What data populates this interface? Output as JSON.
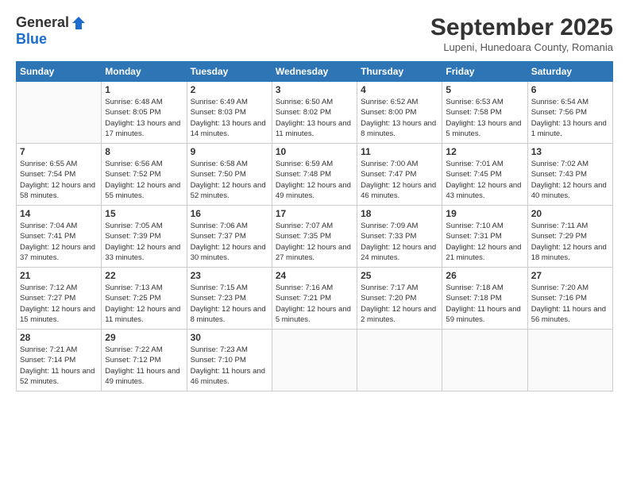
{
  "header": {
    "logo_general": "General",
    "logo_blue": "Blue",
    "month_title": "September 2025",
    "location": "Lupeni, Hunedoara County, Romania"
  },
  "weekdays": [
    "Sunday",
    "Monday",
    "Tuesday",
    "Wednesday",
    "Thursday",
    "Friday",
    "Saturday"
  ],
  "weeks": [
    [
      {
        "day": "",
        "sunrise": "",
        "sunset": "",
        "daylight": ""
      },
      {
        "day": "1",
        "sunrise": "Sunrise: 6:48 AM",
        "sunset": "Sunset: 8:05 PM",
        "daylight": "Daylight: 13 hours and 17 minutes."
      },
      {
        "day": "2",
        "sunrise": "Sunrise: 6:49 AM",
        "sunset": "Sunset: 8:03 PM",
        "daylight": "Daylight: 13 hours and 14 minutes."
      },
      {
        "day": "3",
        "sunrise": "Sunrise: 6:50 AM",
        "sunset": "Sunset: 8:02 PM",
        "daylight": "Daylight: 13 hours and 11 minutes."
      },
      {
        "day": "4",
        "sunrise": "Sunrise: 6:52 AM",
        "sunset": "Sunset: 8:00 PM",
        "daylight": "Daylight: 13 hours and 8 minutes."
      },
      {
        "day": "5",
        "sunrise": "Sunrise: 6:53 AM",
        "sunset": "Sunset: 7:58 PM",
        "daylight": "Daylight: 13 hours and 5 minutes."
      },
      {
        "day": "6",
        "sunrise": "Sunrise: 6:54 AM",
        "sunset": "Sunset: 7:56 PM",
        "daylight": "Daylight: 13 hours and 1 minute."
      }
    ],
    [
      {
        "day": "7",
        "sunrise": "Sunrise: 6:55 AM",
        "sunset": "Sunset: 7:54 PM",
        "daylight": "Daylight: 12 hours and 58 minutes."
      },
      {
        "day": "8",
        "sunrise": "Sunrise: 6:56 AM",
        "sunset": "Sunset: 7:52 PM",
        "daylight": "Daylight: 12 hours and 55 minutes."
      },
      {
        "day": "9",
        "sunrise": "Sunrise: 6:58 AM",
        "sunset": "Sunset: 7:50 PM",
        "daylight": "Daylight: 12 hours and 52 minutes."
      },
      {
        "day": "10",
        "sunrise": "Sunrise: 6:59 AM",
        "sunset": "Sunset: 7:48 PM",
        "daylight": "Daylight: 12 hours and 49 minutes."
      },
      {
        "day": "11",
        "sunrise": "Sunrise: 7:00 AM",
        "sunset": "Sunset: 7:47 PM",
        "daylight": "Daylight: 12 hours and 46 minutes."
      },
      {
        "day": "12",
        "sunrise": "Sunrise: 7:01 AM",
        "sunset": "Sunset: 7:45 PM",
        "daylight": "Daylight: 12 hours and 43 minutes."
      },
      {
        "day": "13",
        "sunrise": "Sunrise: 7:02 AM",
        "sunset": "Sunset: 7:43 PM",
        "daylight": "Daylight: 12 hours and 40 minutes."
      }
    ],
    [
      {
        "day": "14",
        "sunrise": "Sunrise: 7:04 AM",
        "sunset": "Sunset: 7:41 PM",
        "daylight": "Daylight: 12 hours and 37 minutes."
      },
      {
        "day": "15",
        "sunrise": "Sunrise: 7:05 AM",
        "sunset": "Sunset: 7:39 PM",
        "daylight": "Daylight: 12 hours and 33 minutes."
      },
      {
        "day": "16",
        "sunrise": "Sunrise: 7:06 AM",
        "sunset": "Sunset: 7:37 PM",
        "daylight": "Daylight: 12 hours and 30 minutes."
      },
      {
        "day": "17",
        "sunrise": "Sunrise: 7:07 AM",
        "sunset": "Sunset: 7:35 PM",
        "daylight": "Daylight: 12 hours and 27 minutes."
      },
      {
        "day": "18",
        "sunrise": "Sunrise: 7:09 AM",
        "sunset": "Sunset: 7:33 PM",
        "daylight": "Daylight: 12 hours and 24 minutes."
      },
      {
        "day": "19",
        "sunrise": "Sunrise: 7:10 AM",
        "sunset": "Sunset: 7:31 PM",
        "daylight": "Daylight: 12 hours and 21 minutes."
      },
      {
        "day": "20",
        "sunrise": "Sunrise: 7:11 AM",
        "sunset": "Sunset: 7:29 PM",
        "daylight": "Daylight: 12 hours and 18 minutes."
      }
    ],
    [
      {
        "day": "21",
        "sunrise": "Sunrise: 7:12 AM",
        "sunset": "Sunset: 7:27 PM",
        "daylight": "Daylight: 12 hours and 15 minutes."
      },
      {
        "day": "22",
        "sunrise": "Sunrise: 7:13 AM",
        "sunset": "Sunset: 7:25 PM",
        "daylight": "Daylight: 12 hours and 11 minutes."
      },
      {
        "day": "23",
        "sunrise": "Sunrise: 7:15 AM",
        "sunset": "Sunset: 7:23 PM",
        "daylight": "Daylight: 12 hours and 8 minutes."
      },
      {
        "day": "24",
        "sunrise": "Sunrise: 7:16 AM",
        "sunset": "Sunset: 7:21 PM",
        "daylight": "Daylight: 12 hours and 5 minutes."
      },
      {
        "day": "25",
        "sunrise": "Sunrise: 7:17 AM",
        "sunset": "Sunset: 7:20 PM",
        "daylight": "Daylight: 12 hours and 2 minutes."
      },
      {
        "day": "26",
        "sunrise": "Sunrise: 7:18 AM",
        "sunset": "Sunset: 7:18 PM",
        "daylight": "Daylight: 11 hours and 59 minutes."
      },
      {
        "day": "27",
        "sunrise": "Sunrise: 7:20 AM",
        "sunset": "Sunset: 7:16 PM",
        "daylight": "Daylight: 11 hours and 56 minutes."
      }
    ],
    [
      {
        "day": "28",
        "sunrise": "Sunrise: 7:21 AM",
        "sunset": "Sunset: 7:14 PM",
        "daylight": "Daylight: 11 hours and 52 minutes."
      },
      {
        "day": "29",
        "sunrise": "Sunrise: 7:22 AM",
        "sunset": "Sunset: 7:12 PM",
        "daylight": "Daylight: 11 hours and 49 minutes."
      },
      {
        "day": "30",
        "sunrise": "Sunrise: 7:23 AM",
        "sunset": "Sunset: 7:10 PM",
        "daylight": "Daylight: 11 hours and 46 minutes."
      },
      {
        "day": "",
        "sunrise": "",
        "sunset": "",
        "daylight": ""
      },
      {
        "day": "",
        "sunrise": "",
        "sunset": "",
        "daylight": ""
      },
      {
        "day": "",
        "sunrise": "",
        "sunset": "",
        "daylight": ""
      },
      {
        "day": "",
        "sunrise": "",
        "sunset": "",
        "daylight": ""
      }
    ]
  ]
}
